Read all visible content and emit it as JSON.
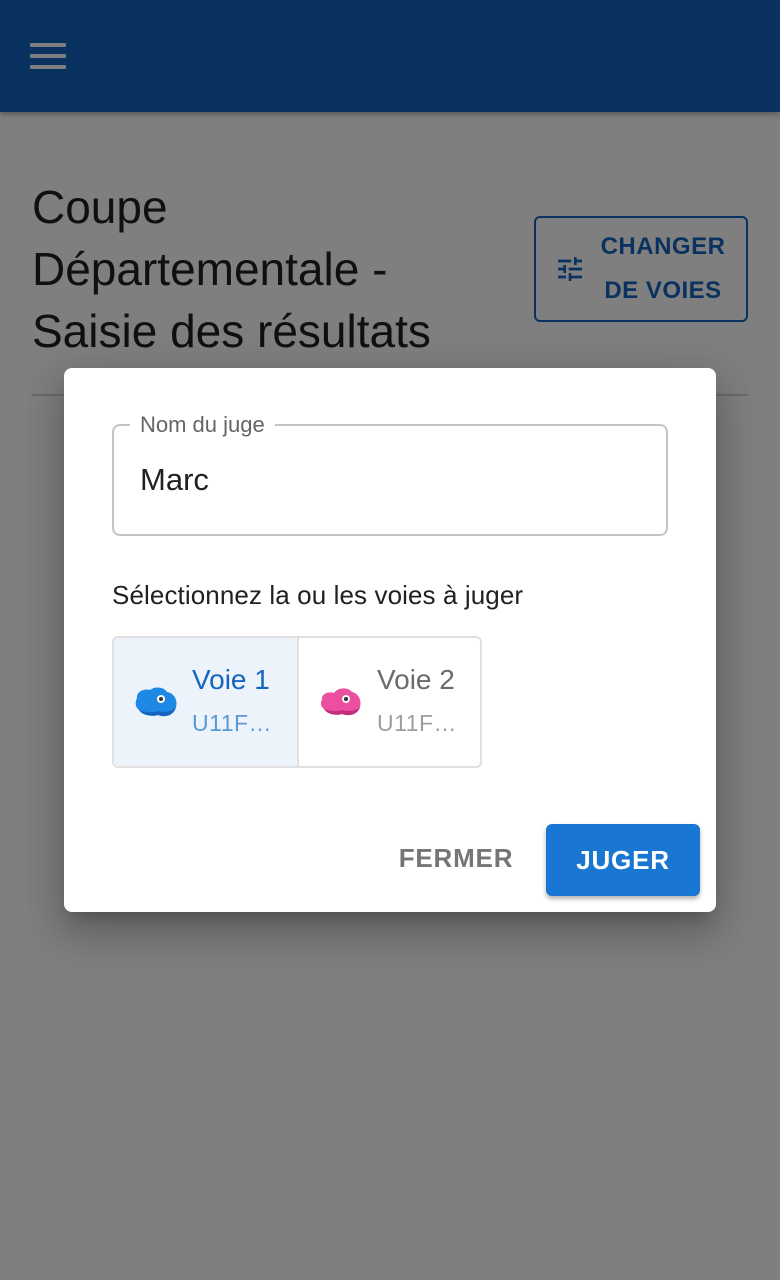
{
  "header": {
    "menu_icon": "menu-icon"
  },
  "page": {
    "title": "Coupe Départementale - Saisie des résultats",
    "change_routes_button": "CHANGER DE VOIES",
    "change_routes_icon": "tune-icon"
  },
  "dialog": {
    "judge_field": {
      "label": "Nom du juge",
      "value": "Marc"
    },
    "prompt": "Sélectionnez la ou les voies à juger",
    "routes": [
      {
        "name": "Voie 1",
        "category": "U11F…",
        "selected": true,
        "hold_color": "#1e88e5",
        "icon": "climbing-hold-icon"
      },
      {
        "name": "Voie 2",
        "category": "U11F …",
        "selected": false,
        "hold_color": "#ec4fa0",
        "icon": "climbing-hold-icon"
      }
    ],
    "close_button": "FERMER",
    "judge_button": "JUGER"
  },
  "colors": {
    "primary": "#1565c0",
    "button": "#1976d2",
    "selected_bg": "#edf3fb"
  }
}
